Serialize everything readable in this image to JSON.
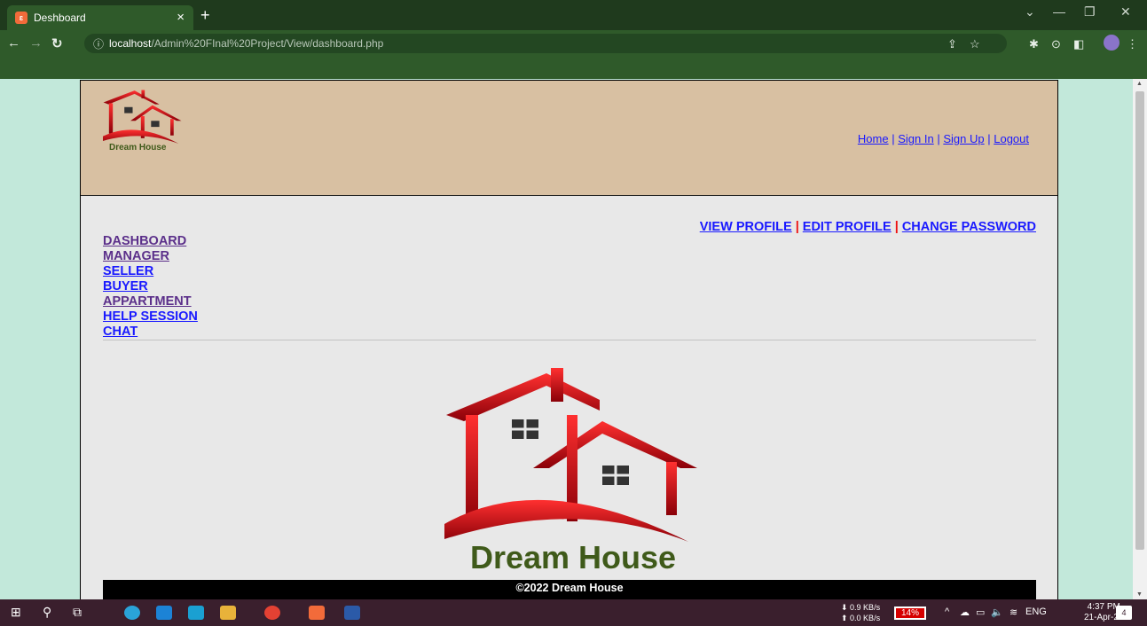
{
  "browser": {
    "tab_title": "Deshboard",
    "tab_close": "×",
    "new_tab": "+",
    "url_host": "localhost",
    "url_path": "/Admin%20FInal%20Project/View/dashboard.php"
  },
  "header": {
    "logo_text": "Dream House",
    "links": [
      "Home",
      "Sign In",
      "Sign Up",
      "Logout"
    ],
    "separator": "|"
  },
  "profile_links": [
    "VIEW PROFILE",
    "EDIT PROFILE",
    "CHANGE PASSWORD"
  ],
  "side_menu": [
    "DASHBOARD",
    "MANAGER",
    "SELLER",
    "BUYER",
    "APPARTMENT",
    "HELP SESSION",
    "CHAT"
  ],
  "main_logo_text": "Dream House",
  "footer_text": "©2022 Dream House",
  "taskbar": {
    "net_down": "0.9 KB/s",
    "net_up": "0.0 KB/s",
    "battery": "14%",
    "language": "ENG",
    "time": "4:37 PM",
    "date": "21-Apr-23",
    "notifications": "4"
  },
  "colors": {
    "chrome": "#2f5a2a",
    "header_bg": "#d8c0a2",
    "page_bg": "#e8e8e8",
    "viewport_bg": "#c2e8da",
    "link": "#1a1aff",
    "separator_red": "#e11111",
    "logo_red": "#d4141c",
    "logo_green": "#3f5a1a"
  }
}
